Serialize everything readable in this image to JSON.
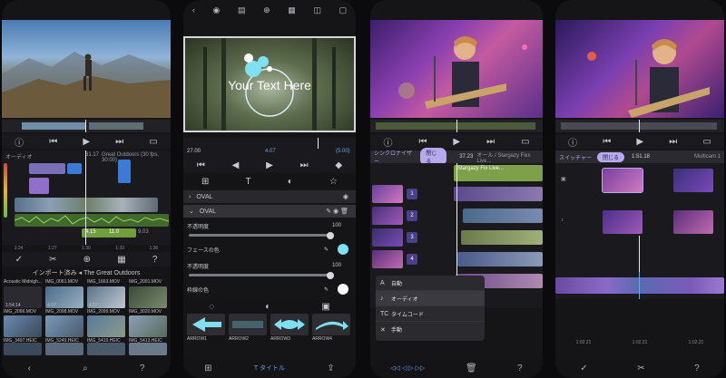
{
  "phone1": {
    "import_title": "インポート済み ◂ The Great Outdoors",
    "header_timecode": "31.17",
    "header_label": "Great Outdoors (30 fps, 30:00)",
    "track_label": "オーディオ",
    "clip_times": [
      "4.15",
      "11.0",
      "9.03"
    ],
    "ruler": [
      "1:24",
      "1:27",
      "1:30",
      "1:33",
      "1:36"
    ],
    "media": [
      {
        "name": "Acoustic Midnigh...",
        "dur": "1:54.14"
      },
      {
        "name": "IMG_0061.MOV",
        "dur": "4.07"
      },
      {
        "name": "IMG_1663.MOV",
        "dur": "4.07"
      },
      {
        "name": "IMG_2001.MOV",
        "dur": ""
      },
      {
        "name": "IMG_2096.MOV",
        "dur": ""
      },
      {
        "name": "IMG_2098.MOV",
        "dur": ""
      },
      {
        "name": "IMG_2099.MOV",
        "dur": ""
      },
      {
        "name": "IMG_3020.MOV",
        "dur": ""
      },
      {
        "name": "IMG_3497.HEIC",
        "dur": ""
      },
      {
        "name": "IMG_5240.HEIC",
        "dur": ""
      },
      {
        "name": "IMG_5410.HEIC",
        "dur": ""
      },
      {
        "name": "IMG_5413.HEIC",
        "dur": ""
      }
    ]
  },
  "phone2": {
    "overlay_text": "Your Text Here",
    "time_start": "27.00",
    "time_mid": "4.07",
    "time_end": "(5.00)",
    "section1": "OVAL",
    "section2": "OVAL",
    "opacity_label_1": "不透明度",
    "opacity_value_1": "100",
    "face_color_label": "フェースの色",
    "opacity_label_2": "不透明度",
    "opacity_value_2": "100",
    "border_color_label": "枠線の色",
    "shapes": [
      "ARROW1",
      "ARROW2",
      "ARROW3",
      "ARROW4"
    ],
    "bottom_label": "タイトル",
    "colors": {
      "face": "#7fe0f2",
      "border": "#ffffff"
    }
  },
  "phone3": {
    "header_label": "シンクロナイザー",
    "header_pill": "閉じる",
    "timecode": "37.23",
    "timecode_label": "オール / Stargazy Fixx Live...",
    "clip_title": "Stargazy Fix Live...",
    "angles": [
      "1",
      "2",
      "3",
      "4",
      "5"
    ],
    "menu": [
      {
        "icon": "A",
        "label": "自動"
      },
      {
        "icon": "♪",
        "label": "オーディオ"
      },
      {
        "icon": "TC",
        "label": "タイムコード"
      },
      {
        "icon": "✕",
        "label": "手動"
      }
    ]
  },
  "phone4": {
    "header_label": "スイッチャー",
    "header_pill": "閉じる",
    "timecode": "1:51.18",
    "right_label": "Multicam 1",
    "ruler": [
      "1:02.21",
      "1:02.21",
      "1:02.21"
    ]
  },
  "accent": {
    "purple": "#b7a9ef",
    "blue": "#3a7bd5",
    "green": "#6fa03c"
  }
}
